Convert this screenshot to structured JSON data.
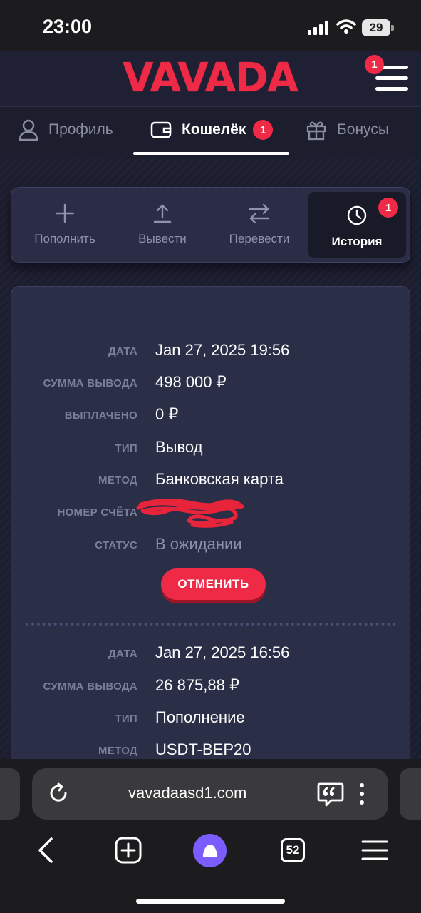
{
  "status_bar": {
    "time": "23:00",
    "battery": "29"
  },
  "header": {
    "logo": "VAVADA",
    "menu_badge": "1"
  },
  "tabs": [
    {
      "label": "Профиль",
      "icon": "user-icon"
    },
    {
      "label": "Кошелёк",
      "icon": "wallet-icon",
      "badge": "1",
      "active": true
    },
    {
      "label": "Бонусы",
      "icon": "gift-icon"
    }
  ],
  "wallet_actions": [
    {
      "label": "Пополнить",
      "icon": "plus-icon"
    },
    {
      "label": "Вывести",
      "icon": "upload-icon"
    },
    {
      "label": "Перевести",
      "icon": "transfer-icon"
    },
    {
      "label": "История",
      "icon": "clock-icon",
      "badge": "1",
      "active": true
    }
  ],
  "history": {
    "entries": [
      {
        "rows": [
          {
            "label": "ДАТА",
            "value": "Jan 27, 2025 19:56"
          },
          {
            "label": "СУММА ВЫВОДА",
            "value": "498 000 ₽"
          },
          {
            "label": "ВЫПЛАЧЕНО",
            "value": "0 ₽"
          },
          {
            "label": "ТИП",
            "value": "Вывод"
          },
          {
            "label": "МЕТОД",
            "value": "Банковская карта"
          },
          {
            "label": "НОМЕР СЧЁТА",
            "value": ""
          },
          {
            "label": "СТАТУС",
            "value": "В ожидании"
          }
        ],
        "cancel_label": "ОТМЕНИТЬ"
      },
      {
        "rows": [
          {
            "label": "ДАТА",
            "value": "Jan 27, 2025 16:56"
          },
          {
            "label": "СУММА ВЫВОДА",
            "value": "26 875,88 ₽"
          },
          {
            "label": "ТИП",
            "value": "Пополнение"
          },
          {
            "label": "МЕТОД",
            "value": "USDT-BEP20"
          }
        ]
      }
    ]
  },
  "browser": {
    "url": "vavadaasd1.com",
    "tabs_count": "52"
  },
  "colors": {
    "accent": "#ef2a47",
    "background": "#1c1d2f",
    "card": "#2b2e47"
  }
}
